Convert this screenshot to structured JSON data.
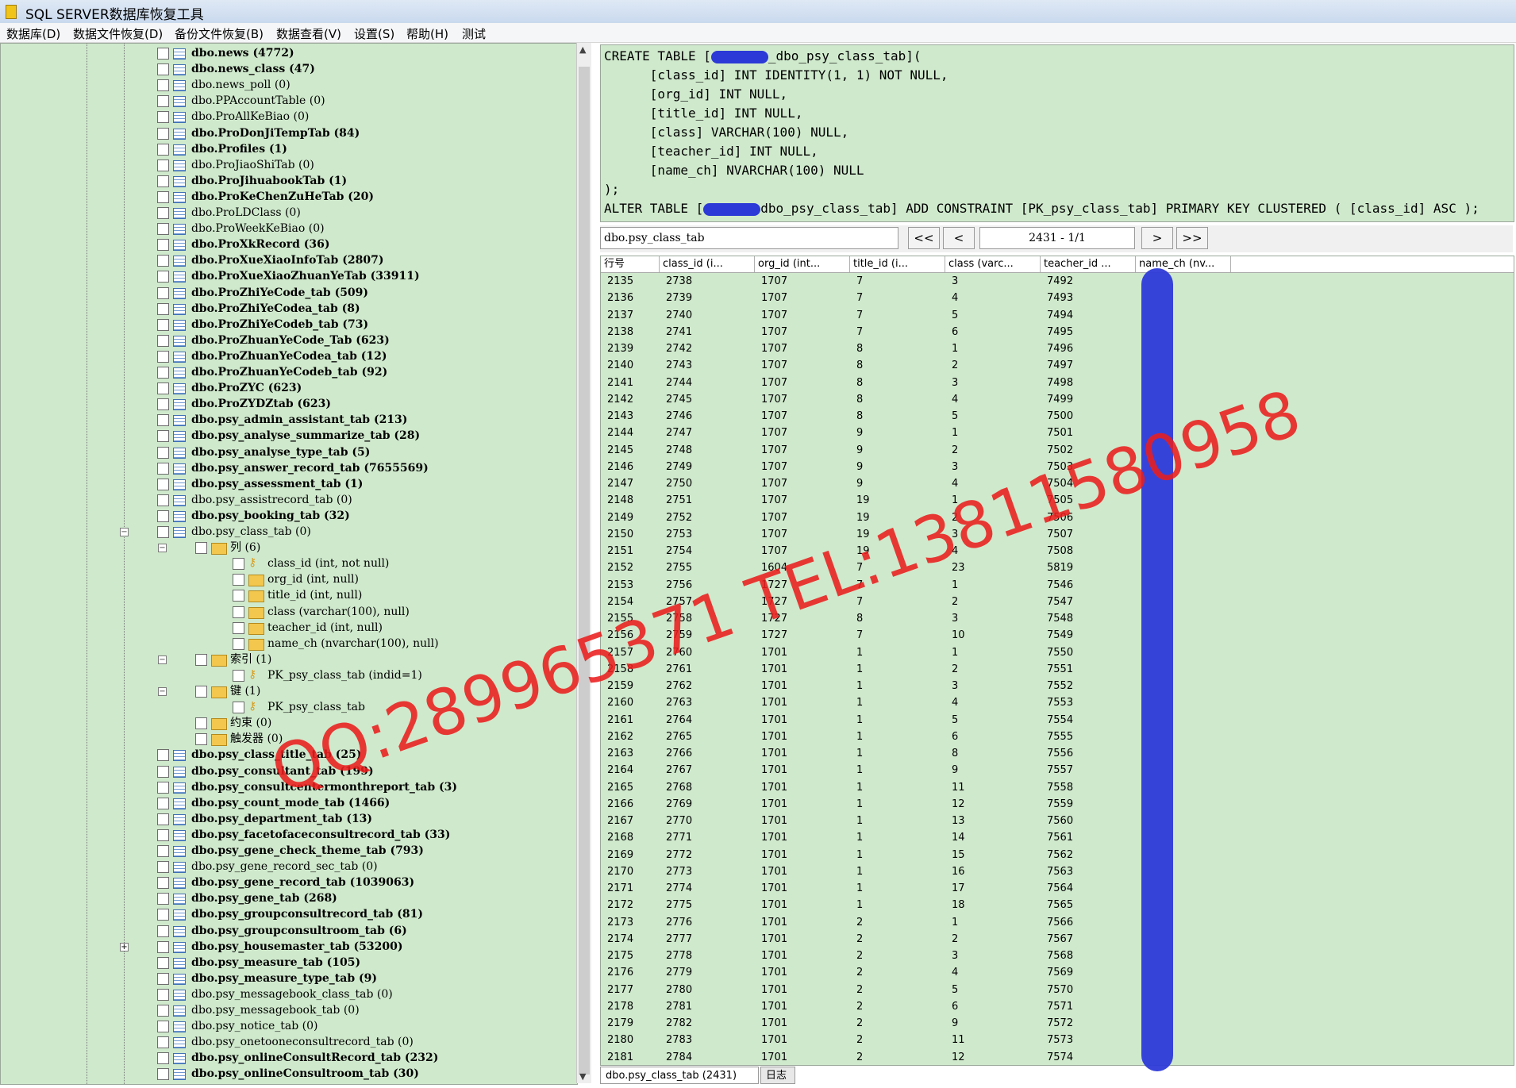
{
  "window": {
    "title": "SQL SERVER数据库恢复工具"
  },
  "menu": [
    "数据库(D)",
    "数据文件恢复(D)",
    "备份文件恢复(B)",
    "数据查看(V)",
    "设置(S)",
    "帮助(H)",
    "测试"
  ],
  "tree": {
    "tables_before": [
      {
        "label": "dbo.news (4772)",
        "bold": true
      },
      {
        "label": "dbo.news_class (47)",
        "bold": true
      },
      {
        "label": "dbo.news_poll (0)",
        "bold": false
      },
      {
        "label": "dbo.PPAccountTable (0)",
        "bold": false
      },
      {
        "label": "dbo.ProAllKeBiao (0)",
        "bold": false
      },
      {
        "label": "dbo.ProDonJiTempTab (84)",
        "bold": true
      },
      {
        "label": "dbo.Profiles (1)",
        "bold": true
      },
      {
        "label": "dbo.ProJiaoShiTab (0)",
        "bold": false
      },
      {
        "label": "dbo.ProJihuabookTab (1)",
        "bold": true
      },
      {
        "label": "dbo.ProKeChenZuHeTab (20)",
        "bold": true
      },
      {
        "label": "dbo.ProLDClass (0)",
        "bold": false
      },
      {
        "label": "dbo.ProWeekKeBiao (0)",
        "bold": false
      },
      {
        "label": "dbo.ProXkRecord (36)",
        "bold": true
      },
      {
        "label": "dbo.ProXueXiaoInfoTab (2807)",
        "bold": true
      },
      {
        "label": "dbo.ProXueXiaoZhuanYeTab (33911)",
        "bold": true
      },
      {
        "label": "dbo.ProZhiYeCode_tab (509)",
        "bold": true
      },
      {
        "label": "dbo.ProZhiYeCodea_tab (8)",
        "bold": true
      },
      {
        "label": "dbo.ProZhiYeCodeb_tab (73)",
        "bold": true
      },
      {
        "label": "dbo.ProZhuanYeCode_Tab (623)",
        "bold": true
      },
      {
        "label": "dbo.ProZhuanYeCodea_tab (12)",
        "bold": true
      },
      {
        "label": "dbo.ProZhuanYeCodeb_tab (92)",
        "bold": true
      },
      {
        "label": "dbo.ProZYC (623)",
        "bold": true
      },
      {
        "label": "dbo.ProZYDZtab (623)",
        "bold": true
      },
      {
        "label": "dbo.psy_admin_assistant_tab (213)",
        "bold": true
      },
      {
        "label": "dbo.psy_analyse_summarize_tab (28)",
        "bold": true
      },
      {
        "label": "dbo.psy_analyse_type_tab (5)",
        "bold": true
      },
      {
        "label": "dbo.psy_answer_record_tab (7655569)",
        "bold": true
      },
      {
        "label": "dbo.psy_assessment_tab (1)",
        "bold": true
      },
      {
        "label": "dbo.psy_assistrecord_tab (0)",
        "bold": false
      },
      {
        "label": "dbo.psy_booking_tab (32)",
        "bold": true
      },
      {
        "label": "dbo.psy_class_tab (0)",
        "bold": false
      }
    ],
    "expanded": [
      {
        "label": "列 (6)",
        "level": 1,
        "icon": "folder",
        "exp": "-"
      },
      {
        "label": "class_id (int, not null)",
        "level": 2,
        "icon": "key"
      },
      {
        "label": "org_id (int, null)",
        "level": 2,
        "icon": "folder"
      },
      {
        "label": "title_id (int, null)",
        "level": 2,
        "icon": "folder"
      },
      {
        "label": "class (varchar(100), null)",
        "level": 2,
        "icon": "folder"
      },
      {
        "label": "teacher_id (int, null)",
        "level": 2,
        "icon": "folder"
      },
      {
        "label": "name_ch (nvarchar(100), null)",
        "level": 2,
        "icon": "folder"
      },
      {
        "label": "索引 (1)",
        "level": 1,
        "icon": "folder",
        "exp": "-"
      },
      {
        "label": "PK_psy_class_tab (indid=1)",
        "level": 2,
        "icon": "key"
      },
      {
        "label": "键 (1)",
        "level": 1,
        "icon": "folder",
        "exp": "-"
      },
      {
        "label": "PK_psy_class_tab",
        "level": 2,
        "icon": "key"
      },
      {
        "label": "约束 (0)",
        "level": 1,
        "icon": "folder"
      },
      {
        "label": "触发器 (0)",
        "level": 1,
        "icon": "folder"
      }
    ],
    "tables_after": [
      {
        "label": "dbo.psy_class_title_tab (25)",
        "bold": true
      },
      {
        "label": "dbo.psy_consultant_tab (199)",
        "bold": true
      },
      {
        "label": "dbo.psy_consultcentermonthreport_tab (3)",
        "bold": true
      },
      {
        "label": "dbo.psy_count_mode_tab (1466)",
        "bold": true
      },
      {
        "label": "dbo.psy_department_tab (13)",
        "bold": true
      },
      {
        "label": "dbo.psy_facetofaceconsultrecord_tab (33)",
        "bold": true
      },
      {
        "label": "dbo.psy_gene_check_theme_tab (793)",
        "bold": true
      },
      {
        "label": "dbo.psy_gene_record_sec_tab (0)",
        "bold": false
      },
      {
        "label": "dbo.psy_gene_record_tab (1039063)",
        "bold": true
      },
      {
        "label": "dbo.psy_gene_tab (268)",
        "bold": true
      },
      {
        "label": "dbo.psy_groupconsultrecord_tab (81)",
        "bold": true
      },
      {
        "label": "dbo.psy_groupconsultroom_tab (6)",
        "bold": true
      },
      {
        "label": "dbo.psy_housemaster_tab (53200)",
        "bold": true
      },
      {
        "label": "dbo.psy_measure_tab (105)",
        "bold": true
      },
      {
        "label": "dbo.psy_measure_type_tab (9)",
        "bold": true
      },
      {
        "label": "dbo.psy_messagebook_class_tab (0)",
        "bold": false
      },
      {
        "label": "dbo.psy_messagebook_tab (0)",
        "bold": false
      },
      {
        "label": "dbo.psy_notice_tab (0)",
        "bold": false
      },
      {
        "label": "dbo.psy_onetooneconsultrecord_tab (0)",
        "bold": false
      },
      {
        "label": "dbo.psy_onlineConsultRecord_tab (232)",
        "bold": true
      },
      {
        "label": "dbo.psy_onlineConsultroom_tab (30)",
        "bold": true
      }
    ]
  },
  "sql": {
    "lines": [
      "CREATE TABLE [",
      "      [class_id] INT IDENTITY(1, 1) NOT NULL,",
      "      [org_id] INT NULL,",
      "      [title_id] INT NULL,",
      "      [class] VARCHAR(100) NULL,",
      "      [teacher_id] INT NULL,",
      "      [name_ch] NVARCHAR(100) NULL",
      ");",
      "ALTER TABLE ["
    ],
    "line0_suffix": "_dbo_psy_class_tab](",
    "line8_suffix": "dbo_psy_class_tab] ADD CONSTRAINT [PK_psy_class_tab] PRIMARY KEY CLUSTERED ( [class_id] ASC );"
  },
  "pager": {
    "table_name": "dbo.psy_class_tab",
    "first": "<<",
    "prev": "<",
    "page_info": "2431 - 1/1",
    "next": ">",
    "last": ">>"
  },
  "grid": {
    "headers": [
      "行号",
      "class_id (i...",
      "org_id (int...",
      "title_id (i...",
      "class (varc...",
      "teacher_id ...",
      "name_ch (nv..."
    ],
    "rows": [
      [
        "2135",
        "2738",
        "1707",
        "7",
        "3",
        "7492"
      ],
      [
        "2136",
        "2739",
        "1707",
        "7",
        "4",
        "7493"
      ],
      [
        "2137",
        "2740",
        "1707",
        "7",
        "5",
        "7494"
      ],
      [
        "2138",
        "2741",
        "1707",
        "7",
        "6",
        "7495"
      ],
      [
        "2139",
        "2742",
        "1707",
        "8",
        "1",
        "7496"
      ],
      [
        "2140",
        "2743",
        "1707",
        "8",
        "2",
        "7497"
      ],
      [
        "2141",
        "2744",
        "1707",
        "8",
        "3",
        "7498"
      ],
      [
        "2142",
        "2745",
        "1707",
        "8",
        "4",
        "7499"
      ],
      [
        "2143",
        "2746",
        "1707",
        "8",
        "5",
        "7500"
      ],
      [
        "2144",
        "2747",
        "1707",
        "9",
        "1",
        "7501"
      ],
      [
        "2145",
        "2748",
        "1707",
        "9",
        "2",
        "7502"
      ],
      [
        "2146",
        "2749",
        "1707",
        "9",
        "3",
        "7503"
      ],
      [
        "2147",
        "2750",
        "1707",
        "9",
        "4",
        "7504"
      ],
      [
        "2148",
        "2751",
        "1707",
        "19",
        "1",
        "7505"
      ],
      [
        "2149",
        "2752",
        "1707",
        "19",
        "2",
        "7506"
      ],
      [
        "2150",
        "2753",
        "1707",
        "19",
        "3",
        "7507"
      ],
      [
        "2151",
        "2754",
        "1707",
        "19",
        "4",
        "7508"
      ],
      [
        "2152",
        "2755",
        "1604",
        "7",
        "23",
        "5819"
      ],
      [
        "2153",
        "2756",
        "1727",
        "7",
        "1",
        "7546"
      ],
      [
        "2154",
        "2757",
        "1727",
        "7",
        "2",
        "7547"
      ],
      [
        "2155",
        "2758",
        "1727",
        "8",
        "3",
        "7548"
      ],
      [
        "2156",
        "2759",
        "1727",
        "7",
        "10",
        "7549"
      ],
      [
        "2157",
        "2760",
        "1701",
        "1",
        "1",
        "7550"
      ],
      [
        "2158",
        "2761",
        "1701",
        "1",
        "2",
        "7551"
      ],
      [
        "2159",
        "2762",
        "1701",
        "1",
        "3",
        "7552"
      ],
      [
        "2160",
        "2763",
        "1701",
        "1",
        "4",
        "7553"
      ],
      [
        "2161",
        "2764",
        "1701",
        "1",
        "5",
        "7554"
      ],
      [
        "2162",
        "2765",
        "1701",
        "1",
        "6",
        "7555"
      ],
      [
        "2163",
        "2766",
        "1701",
        "1",
        "8",
        "7556"
      ],
      [
        "2164",
        "2767",
        "1701",
        "1",
        "9",
        "7557"
      ],
      [
        "2165",
        "2768",
        "1701",
        "1",
        "11",
        "7558"
      ],
      [
        "2166",
        "2769",
        "1701",
        "1",
        "12",
        "7559"
      ],
      [
        "2167",
        "2770",
        "1701",
        "1",
        "13",
        "7560"
      ],
      [
        "2168",
        "2771",
        "1701",
        "1",
        "14",
        "7561"
      ],
      [
        "2169",
        "2772",
        "1701",
        "1",
        "15",
        "7562"
      ],
      [
        "2170",
        "2773",
        "1701",
        "1",
        "16",
        "7563"
      ],
      [
        "2171",
        "2774",
        "1701",
        "1",
        "17",
        "7564"
      ],
      [
        "2172",
        "2775",
        "1701",
        "1",
        "18",
        "7565"
      ],
      [
        "2173",
        "2776",
        "1701",
        "2",
        "1",
        "7566"
      ],
      [
        "2174",
        "2777",
        "1701",
        "2",
        "2",
        "7567"
      ],
      [
        "2175",
        "2778",
        "1701",
        "2",
        "3",
        "7568"
      ],
      [
        "2176",
        "2779",
        "1701",
        "2",
        "4",
        "7569"
      ],
      [
        "2177",
        "2780",
        "1701",
        "2",
        "5",
        "7570"
      ],
      [
        "2178",
        "2781",
        "1701",
        "2",
        "6",
        "7571"
      ],
      [
        "2179",
        "2782",
        "1701",
        "2",
        "9",
        "7572"
      ],
      [
        "2180",
        "2783",
        "1701",
        "2",
        "11",
        "7573"
      ],
      [
        "2181",
        "2784",
        "1701",
        "2",
        "12",
        "7574"
      ]
    ]
  },
  "bottom_tabs": [
    "dbo.psy_class_tab (2431)",
    "日志"
  ],
  "watermark": "QQ:289965371 TEL:13811580958",
  "colors": {
    "pane_bg": "#cfe9cc",
    "redaction": "#2d3ad8",
    "watermark": "#eb1e1e"
  }
}
